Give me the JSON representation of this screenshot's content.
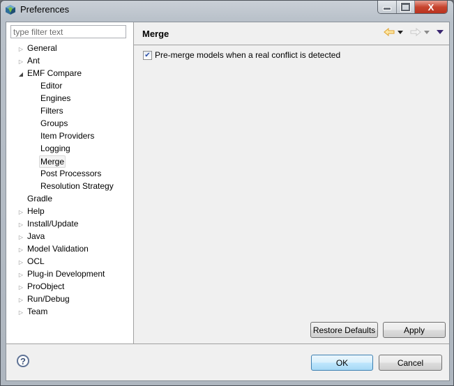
{
  "window": {
    "title": "Preferences",
    "icons": {
      "app": "preferences-cube-icon",
      "minimize": "minimize-icon",
      "maximize": "maximize-icon",
      "close": "close-icon"
    },
    "close_glyph": "X"
  },
  "filter": {
    "placeholder": "type filter text",
    "value": ""
  },
  "tree": {
    "items": [
      {
        "label": "General",
        "level": 0,
        "expandable": true,
        "expanded": false
      },
      {
        "label": "Ant",
        "level": 0,
        "expandable": true,
        "expanded": false
      },
      {
        "label": "EMF Compare",
        "level": 0,
        "expandable": true,
        "expanded": true
      },
      {
        "label": "Editor",
        "level": 1
      },
      {
        "label": "Engines",
        "level": 1
      },
      {
        "label": "Filters",
        "level": 1
      },
      {
        "label": "Groups",
        "level": 1
      },
      {
        "label": "Item Providers",
        "level": 1
      },
      {
        "label": "Logging",
        "level": 1
      },
      {
        "label": "Merge",
        "level": 1,
        "selected": true
      },
      {
        "label": "Post Processors",
        "level": 1
      },
      {
        "label": "Resolution Strategy",
        "level": 1
      },
      {
        "label": "Gradle",
        "level": 0,
        "expandable": false
      },
      {
        "label": "Help",
        "level": 0,
        "expandable": true,
        "expanded": false
      },
      {
        "label": "Install/Update",
        "level": 0,
        "expandable": true,
        "expanded": false
      },
      {
        "label": "Java",
        "level": 0,
        "expandable": true,
        "expanded": false
      },
      {
        "label": "Model Validation",
        "level": 0,
        "expandable": true,
        "expanded": false
      },
      {
        "label": "OCL",
        "level": 0,
        "expandable": true,
        "expanded": false
      },
      {
        "label": "Plug-in Development",
        "level": 0,
        "expandable": true,
        "expanded": false
      },
      {
        "label": "ProObject",
        "level": 0,
        "expandable": true,
        "expanded": false
      },
      {
        "label": "Run/Debug",
        "level": 0,
        "expandable": true,
        "expanded": false
      },
      {
        "label": "Team",
        "level": 0,
        "expandable": true,
        "expanded": false
      }
    ]
  },
  "page": {
    "title": "Merge",
    "nav": {
      "back_icon": "back-arrow-icon",
      "forward_icon": "forward-arrow-icon",
      "menu_icon": "view-menu-icon"
    },
    "options": [
      {
        "label": "Pre-merge models when a real conflict is detected",
        "checked": true
      }
    ],
    "restore_defaults_label": "Restore Defaults",
    "apply_label": "Apply"
  },
  "footer": {
    "help_glyph": "?",
    "ok_label": "OK",
    "cancel_label": "Cancel"
  },
  "colors": {
    "back_arrow": "#f0b73a",
    "forward_arrow_disabled": "#c8c8c8",
    "close_button": "#c7452f",
    "default_button_border": "#3c7fb1"
  }
}
